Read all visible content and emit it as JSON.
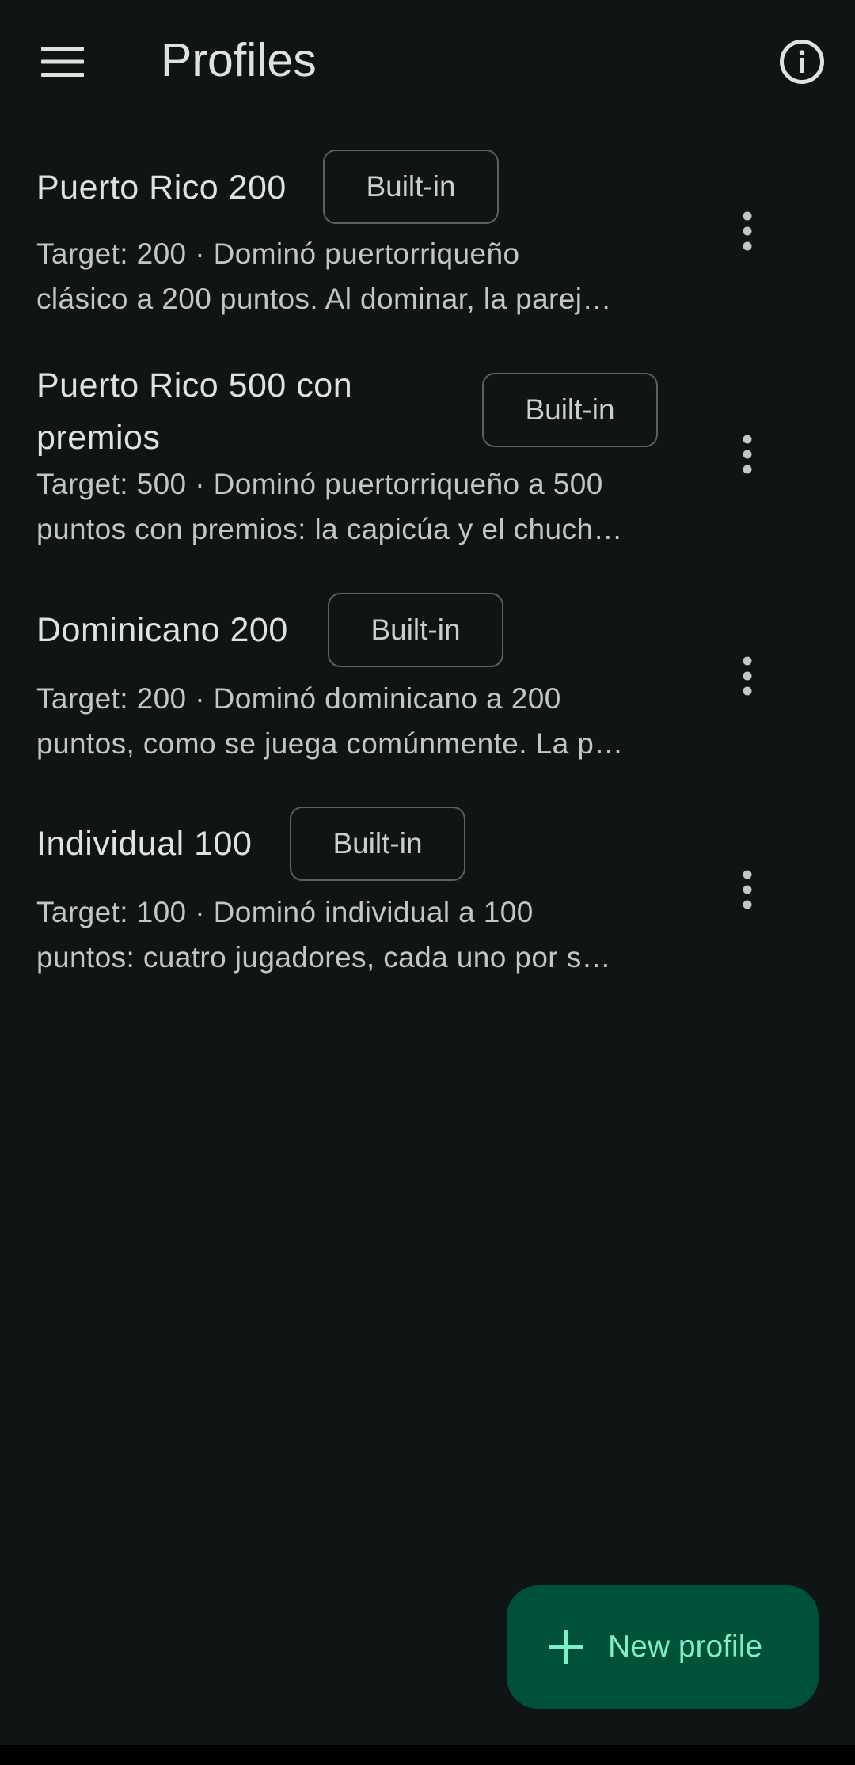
{
  "header": {
    "title": "Profiles",
    "menu_icon": "hamburger-menu-icon",
    "info_icon": "info-circle-icon"
  },
  "profiles": [
    {
      "title_line1": "Puerto Rico 200",
      "title_line2": "",
      "badge": "Built-in",
      "desc_line1": "Target: 200 · Dominó puertorriqueño",
      "desc_line2": "clásico a 200 puntos. Al dominar, la parej…"
    },
    {
      "title_line1": "Puerto Rico 500 con",
      "title_line2": "premios",
      "badge": "Built-in",
      "desc_line1": "Target: 500 · Dominó puertorriqueño a 500",
      "desc_line2": "puntos con premios: la capicúa y el chuch…"
    },
    {
      "title_line1": "Dominicano 200",
      "title_line2": "",
      "badge": "Built-in",
      "desc_line1": "Target: 200 · Dominó dominicano a 200",
      "desc_line2": "puntos, como se juega comúnmente. La p…"
    },
    {
      "title_line1": "Individual 100",
      "title_line2": "",
      "badge": "Built-in",
      "desc_line1": "Target: 100 · Dominó individual a 100",
      "desc_line2": "puntos: cuatro jugadores, cada uno por s…"
    }
  ],
  "fab": {
    "label": "New profile",
    "icon": "plus-icon"
  },
  "colors": {
    "background": "#0f1514",
    "fab_background": "#00513a",
    "fab_foreground": "#7ff0c2",
    "text_primary": "#dde4e0",
    "text_secondary": "#bfc8c4",
    "chip_border": "#5a625f"
  }
}
